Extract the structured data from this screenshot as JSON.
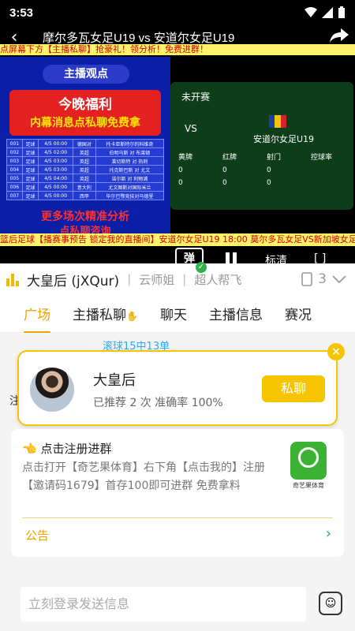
{
  "status_bar": {
    "time": "3:53"
  },
  "video": {
    "title": "摩尔多瓦女足U19 vs 安道尔女足U19",
    "ticker_top": "点屏幕下方【主播私聊】抢豪礼！领分析！免费进群！",
    "ticker_bottom": "篮后足球【播赛事预告 锁定我的直播间】安道尔女足U19 18:00 莫尔多瓦女足VS新加坡女足",
    "poster": {
      "header": "主播观点",
      "headline": "今晚福利",
      "subline": "内幕消息点私聊免费拿",
      "rows": [
        [
          "001",
          "足球",
          "4/5 00:00",
          "德国对",
          "托卡亚斯特尔的科维奇"
        ],
        [
          "002",
          "足球",
          "4/5 02:00",
          "英超",
          "伯明乌斯 对 布莱顿"
        ],
        [
          "003",
          "足球",
          "4/5 03:00",
          "英超",
          "莱切斯特 对 热刺"
        ],
        [
          "004",
          "足球",
          "4/5 03:00",
          "英超",
          "托克斯巴斯 对 尤文"
        ],
        [
          "005",
          "足球",
          "4/5 04:00",
          "英超",
          "诺尔斯 对 利物浦"
        ],
        [
          "006",
          "足球",
          "4/5 00:00",
          "意大利",
          "尤文图斯对国际米兰"
        ],
        [
          "007",
          "足球",
          "4/5 00:00",
          "西甲",
          "毕尔巴鄂竞技对马德里"
        ]
      ],
      "footer1": "更多场次精准分析",
      "footer2": "点私聊咨询"
    },
    "scoreboard": {
      "status": "未开赛",
      "vs": "VS",
      "team": "安道尔女足U19",
      "stats_header": [
        "黄牌",
        "红牌",
        "射门",
        "控球率"
      ],
      "stats_row1": [
        "0",
        "0",
        "0",
        ""
      ],
      "stats_row2": [
        "0",
        "0",
        "0",
        ""
      ]
    },
    "controls": {
      "danmu": "弹",
      "quality": "标清"
    }
  },
  "anchor_row": {
    "name": "大皇后 (jXQur)",
    "tag1": "云师姐",
    "tag2": "超人帮飞",
    "count": "3"
  },
  "tabs": [
    {
      "label": "广场"
    },
    {
      "label": "主播私聊"
    },
    {
      "label": "聊天"
    },
    {
      "label": "主播信息"
    },
    {
      "label": "赛况"
    }
  ],
  "chat": {
    "msg": "滚球15中13单",
    "clipped": "注"
  },
  "card": {
    "name": "大皇后",
    "sub": "已推荐 2 次 准确率 100%",
    "button": "私聊"
  },
  "notice": {
    "head": "点击注册进群",
    "body": "点击打开【奇艺果体育】右下角【点击我的】注册【邀请码1679】首存100即可进群 免费拿料",
    "logo_label": "奇艺果体育",
    "announcement": "公告"
  },
  "bottom": {
    "placeholder": "立刻登录发送信息"
  }
}
